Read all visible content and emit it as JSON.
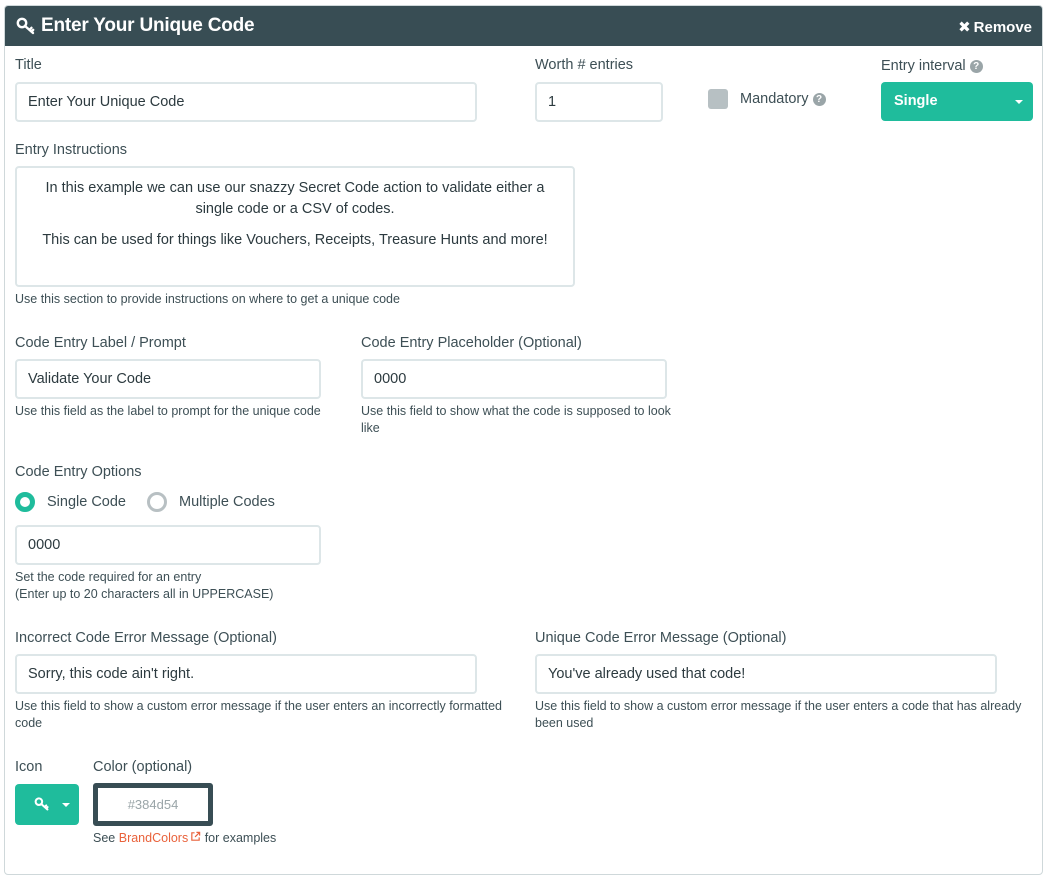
{
  "header": {
    "title": "Enter Your Unique Code",
    "remove_label": "Remove",
    "color": "#384d54"
  },
  "title_field": {
    "label": "Title",
    "value": "Enter Your Unique Code"
  },
  "worth_field": {
    "label": "Worth # entries",
    "value": "1"
  },
  "mandatory": {
    "label": "Mandatory",
    "checked": false
  },
  "entry_interval": {
    "label": "Entry interval",
    "value": "Single"
  },
  "instructions": {
    "label": "Entry Instructions",
    "line1": "In this example we can use our snazzy Secret Code action to validate either a single code or a CSV of codes.",
    "line2": "This can be used for things like Vouchers, Receipts, Treasure Hunts and more!",
    "help": "Use this section to provide instructions on where to get a unique code"
  },
  "code_label": {
    "label": "Code Entry Label / Prompt",
    "value": "Validate Your Code",
    "help": "Use this field as the label to prompt for the unique code"
  },
  "code_placeholder": {
    "label": "Code Entry Placeholder (Optional)",
    "value": "0000",
    "help": "Use this field to show what the code is supposed to look like"
  },
  "code_options": {
    "label": "Code Entry Options",
    "single_label": "Single Code",
    "multiple_label": "Multiple Codes",
    "selected": "Single Code",
    "value": "0000",
    "help1": "Set the code required for an entry",
    "help2": "(Enter up to 20 characters all in UPPERCASE)"
  },
  "incorrect_error": {
    "label": "Incorrect Code Error Message (Optional)",
    "value": "Sorry, this code ain't right.",
    "help": "Use this field to show a custom error message if the user enters an incorrectly formatted code"
  },
  "unique_error": {
    "label": "Unique Code Error Message (Optional)",
    "value": "You've already used that code!",
    "help": "Use this field to show a custom error message if the user enters a code that has already been used"
  },
  "icon_field": {
    "label": "Icon",
    "icon": "key-icon"
  },
  "color_field": {
    "label": "Color (optional)",
    "placeholder": "#384d54",
    "help_prefix": "See",
    "link_text": "BrandColors",
    "help_suffix": "for examples"
  },
  "accent": "#1fbc9c"
}
